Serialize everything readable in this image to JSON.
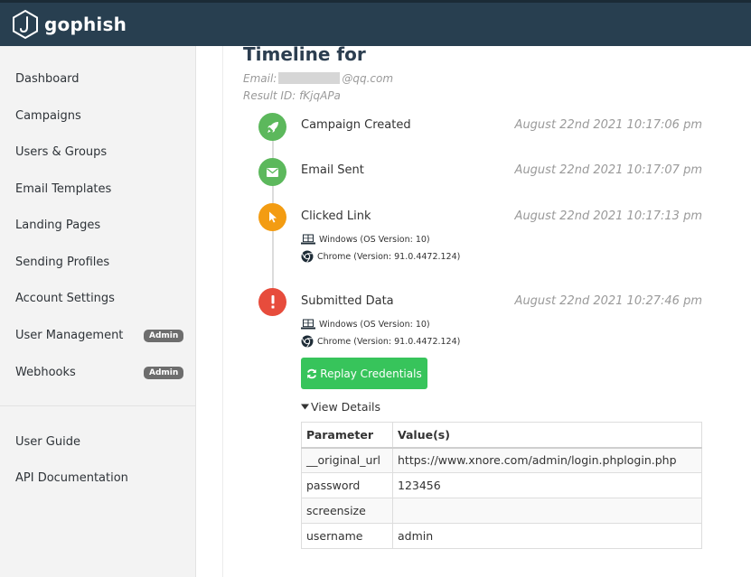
{
  "brand": {
    "name": "gophish"
  },
  "sidebar": {
    "items": [
      {
        "label": "Dashboard"
      },
      {
        "label": "Campaigns"
      },
      {
        "label": "Users & Groups"
      },
      {
        "label": "Email Templates"
      },
      {
        "label": "Landing Pages"
      },
      {
        "label": "Sending Profiles"
      },
      {
        "label": "Account Settings"
      },
      {
        "label": "User Management",
        "badge": "Admin"
      },
      {
        "label": "Webhooks",
        "badge": "Admin"
      }
    ],
    "footer_items": [
      {
        "label": "User Guide"
      },
      {
        "label": "API Documentation"
      }
    ]
  },
  "timeline": {
    "title": "Timeline for",
    "email_prefix": "Email:",
    "email_suffix": "@qq.com",
    "result_id": "Result ID: fKjqAPa",
    "events": [
      {
        "label": "Campaign Created",
        "time": "August 22nd 2021 10:17:06 pm",
        "color": "#5cb85c",
        "icon": "rocket-icon"
      },
      {
        "label": "Email Sent",
        "time": "August 22nd 2021 10:17:07 pm",
        "color": "#5cb85c",
        "icon": "envelope-icon"
      },
      {
        "label": "Clicked Link",
        "time": "August 22nd 2021 10:17:13 pm",
        "color": "#f39c12",
        "icon": "cursor-icon",
        "os": "Windows (OS Version: 10)",
        "browser": "Chrome (Version: 91.0.4472.124)"
      },
      {
        "label": "Submitted Data",
        "time": "August 22nd 2021 10:27:46 pm",
        "color": "#e74c3c",
        "icon": "exclamation-icon",
        "os": "Windows (OS Version: 10)",
        "browser": "Chrome (Version: 91.0.4472.124)"
      }
    ],
    "replay_label": "Replay Credentials",
    "details_label": "View Details",
    "table": {
      "headers": [
        "Parameter",
        "Value(s)"
      ],
      "rows": [
        [
          "__original_url",
          "https://www.xnore.com/admin/login.phplogin.php"
        ],
        [
          "password",
          "123456"
        ],
        [
          "screensize",
          ""
        ],
        [
          "username",
          "admin"
        ]
      ]
    }
  },
  "colors": {
    "topbar": "#283f50",
    "green": "#5cb85c",
    "orange": "#f39c12",
    "red": "#e74c3c",
    "button": "#37c45b"
  }
}
